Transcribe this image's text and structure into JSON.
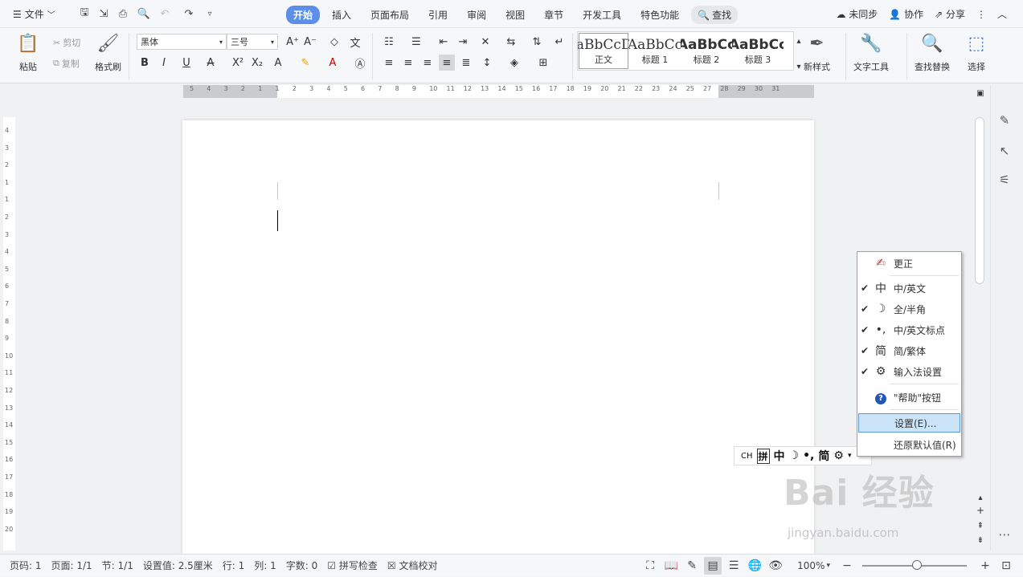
{
  "menubar": {
    "file_label": "文件",
    "tabs": [
      "开始",
      "插入",
      "页面布局",
      "引用",
      "审阅",
      "视图",
      "章节",
      "开发工具",
      "特色功能"
    ],
    "active_tab": "开始",
    "search_label": "查找",
    "sync_label": "未同步",
    "collab_label": "协作",
    "share_label": "分享"
  },
  "ribbon": {
    "paste": "粘贴",
    "cut": "剪切",
    "copy": "复制",
    "format_painter": "格式刷",
    "font_name": "黑体",
    "font_size": "三号",
    "styles": [
      {
        "preview": "AaBbCcDd",
        "label": "正文"
      },
      {
        "preview": "AaBbCc",
        "label": "标题 1"
      },
      {
        "preview": "AaBbCc",
        "label": "标题 2"
      },
      {
        "preview": "AaBbCc",
        "label": "标题 3"
      }
    ],
    "new_style": "新样式",
    "text_tools": "文字工具",
    "find_replace": "查找替换",
    "select": "选择"
  },
  "ruler": {
    "h_labels": [
      "5",
      "4",
      "3",
      "2",
      "1",
      "1",
      "2",
      "3",
      "4",
      "5",
      "6",
      "7",
      "8",
      "9",
      "10",
      "11",
      "12",
      "13",
      "14",
      "15",
      "16",
      "17",
      "18",
      "19",
      "20",
      "21",
      "22",
      "23",
      "24",
      "25",
      "27",
      "28",
      "29",
      "30",
      "31"
    ],
    "v_labels": [
      "4",
      "3",
      "2",
      "1",
      "1",
      "2",
      "3",
      "4",
      "5",
      "6",
      "7",
      "8",
      "9",
      "10",
      "11",
      "12",
      "13",
      "14",
      "15",
      "16",
      "17",
      "18",
      "19",
      "20"
    ]
  },
  "ime_toolbar": {
    "items": [
      "CH",
      "拼",
      "中",
      "☽",
      "•,",
      "简",
      "⚙",
      "▾"
    ]
  },
  "context_menu": {
    "items": [
      {
        "label": "更正",
        "checked": false,
        "icon": "correct-icon"
      },
      {
        "label": "中/英文",
        "checked": true,
        "icon": "chinese-icon"
      },
      {
        "label": "全/半角",
        "checked": true,
        "icon": "moon-icon"
      },
      {
        "label": "中/英文标点",
        "checked": true,
        "icon": "punctuation-icon"
      },
      {
        "label": "简/繁体",
        "checked": true,
        "icon": "simplified-icon"
      },
      {
        "label": "输入法设置",
        "checked": true,
        "icon": "gear-icon"
      },
      {
        "label": "\"帮助\"按钮",
        "checked": false,
        "icon": "help-icon"
      },
      {
        "label": "设置(E)...",
        "checked": false,
        "icon": ""
      },
      {
        "label": "还原默认值(R)",
        "checked": false,
        "icon": ""
      }
    ],
    "highlighted": "设置(E)..."
  },
  "statusbar": {
    "page_num": "页码: 1",
    "page_count": "页面: 1/1",
    "section": "节: 1/1",
    "setting_value": "设置值: 2.5厘米",
    "row": "行: 1",
    "col": "列: 1",
    "word_count": "字数: 0",
    "spell_check": "拼写检查",
    "doc_proof": "文档校对",
    "zoom": "100%"
  },
  "watermark": {
    "brand": "Bai 经验",
    "url": "jingyan.baidu.com"
  }
}
